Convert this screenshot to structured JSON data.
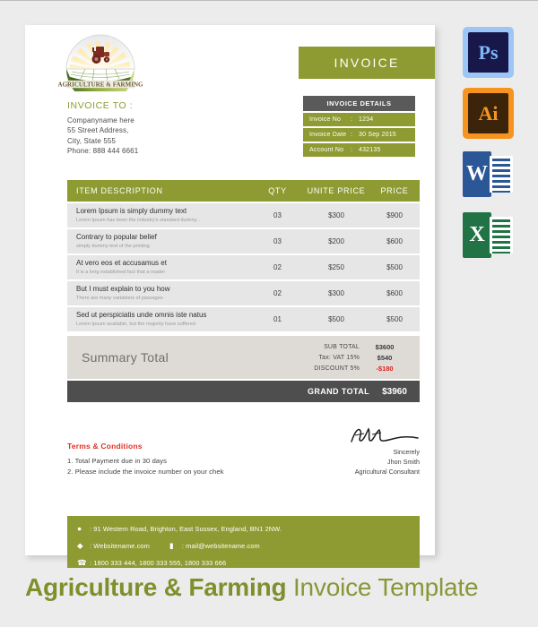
{
  "background_color": "#ececec",
  "accent_green": "#8d9b32",
  "accent_red": "#e03127",
  "dark_gray": "#4e4e4e",
  "invoice": {
    "header_label": "INVOICE",
    "invoice_to": {
      "title": "INVOICE TO :",
      "lines": [
        "Companyname here",
        "55 Street Address,",
        "City, State 555",
        "Phone: 888 444 6661"
      ]
    },
    "details": {
      "title": "INVOICE DETAILS",
      "rows": [
        {
          "key": "Invoice No",
          "sep": ":",
          "value": "1234"
        },
        {
          "key": "Invoice Date",
          "sep": ":",
          "value": "30 Sep 2015"
        },
        {
          "key": "Account No",
          "sep": ":",
          "value": "432135"
        }
      ]
    },
    "table": {
      "columns": [
        "ITEM DESCRIPTION",
        "QTY",
        "UNITE PRICE",
        "PRICE"
      ],
      "rows": [
        {
          "title": "Lorem Ipsum is simply dummy text",
          "subtitle": "Lorem Ipsum has been the industry's standard dummy .",
          "qty": "03",
          "unit_price": "$300",
          "price": "$900"
        },
        {
          "title": "Contrary to popular belief",
          "subtitle": "simply dummy text of the printing",
          "qty": "03",
          "unit_price": "$200",
          "price": "$600"
        },
        {
          "title": "At vero eos et accusamus et",
          "subtitle": "It is a long established fact that a reader",
          "qty": "02",
          "unit_price": "$250",
          "price": "$500"
        },
        {
          "title": "But I must explain to you how",
          "subtitle": "There are many variations of passages",
          "qty": "02",
          "unit_price": "$300",
          "price": "$600"
        },
        {
          "title": "Sed ut perspiciatis unde omnis iste natus",
          "subtitle": "Lorem Ipsum available, but the majority have suffered",
          "qty": "01",
          "unit_price": "$500",
          "price": "$500"
        }
      ]
    },
    "summary": {
      "title": "Summary Total",
      "rows": [
        {
          "label": "SUB TOTAL",
          "value": "$3600",
          "negative": false
        },
        {
          "label": "Tax: VAT 15%",
          "value": "$540",
          "negative": false
        },
        {
          "label": "DISCOUNT 5%",
          "value": "-$180",
          "negative": true
        }
      ],
      "grand_label": "GRAND TOTAL",
      "grand_value": "$3960"
    },
    "terms": {
      "title": "Terms & Conditions",
      "lines": [
        "1. Total Payment due in 30 days",
        "2. Please include the invoice number on your chek"
      ]
    },
    "signature": {
      "sincerely": "Sincerely",
      "name": "Jhon Smith",
      "role": "Agricultural Consultant"
    },
    "footer": {
      "address": ": 91 Western Road, Brighton, East Sussex, England, BN1 2NW.",
      "website": ": Websitename.com",
      "email": ": mail@websitename.com",
      "phones": ": 1800 333 444,   1800 333 555,  1800 333 666"
    },
    "logo_text": "AGRICULTURE & FARMING"
  },
  "app_icons": [
    {
      "name": "photoshop",
      "label": "Ps"
    },
    {
      "name": "illustrator",
      "label": "Ai"
    },
    {
      "name": "word",
      "label": "W"
    },
    {
      "name": "excel",
      "label": "X"
    }
  ],
  "bottom_title": {
    "bold": "Agriculture & Farming",
    "regular": " Invoice Template"
  }
}
